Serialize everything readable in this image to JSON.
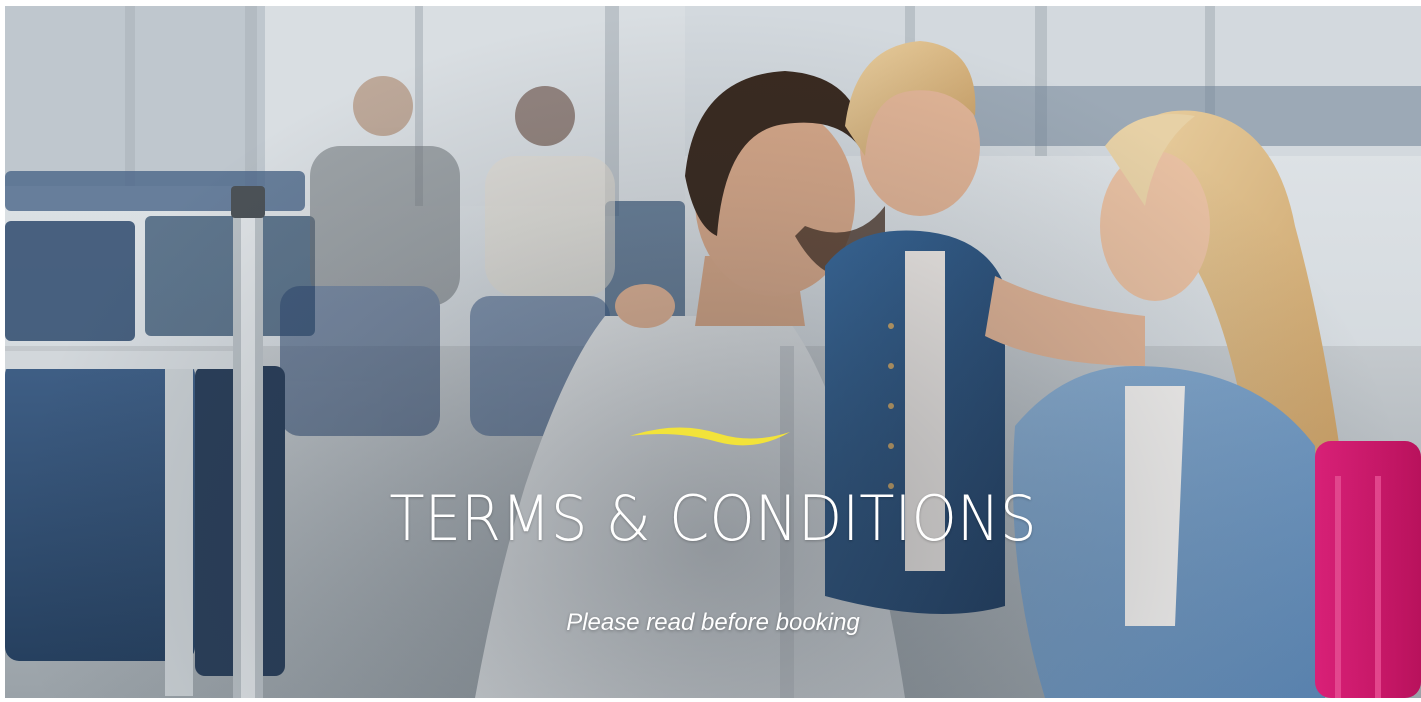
{
  "hero": {
    "title": "TERMS & CONDITIONS",
    "subtitle": "Please read before booking",
    "accent_color": "#f2e33a",
    "text_color": "#ffffff",
    "image_description_icon": "family-airport-photo"
  }
}
